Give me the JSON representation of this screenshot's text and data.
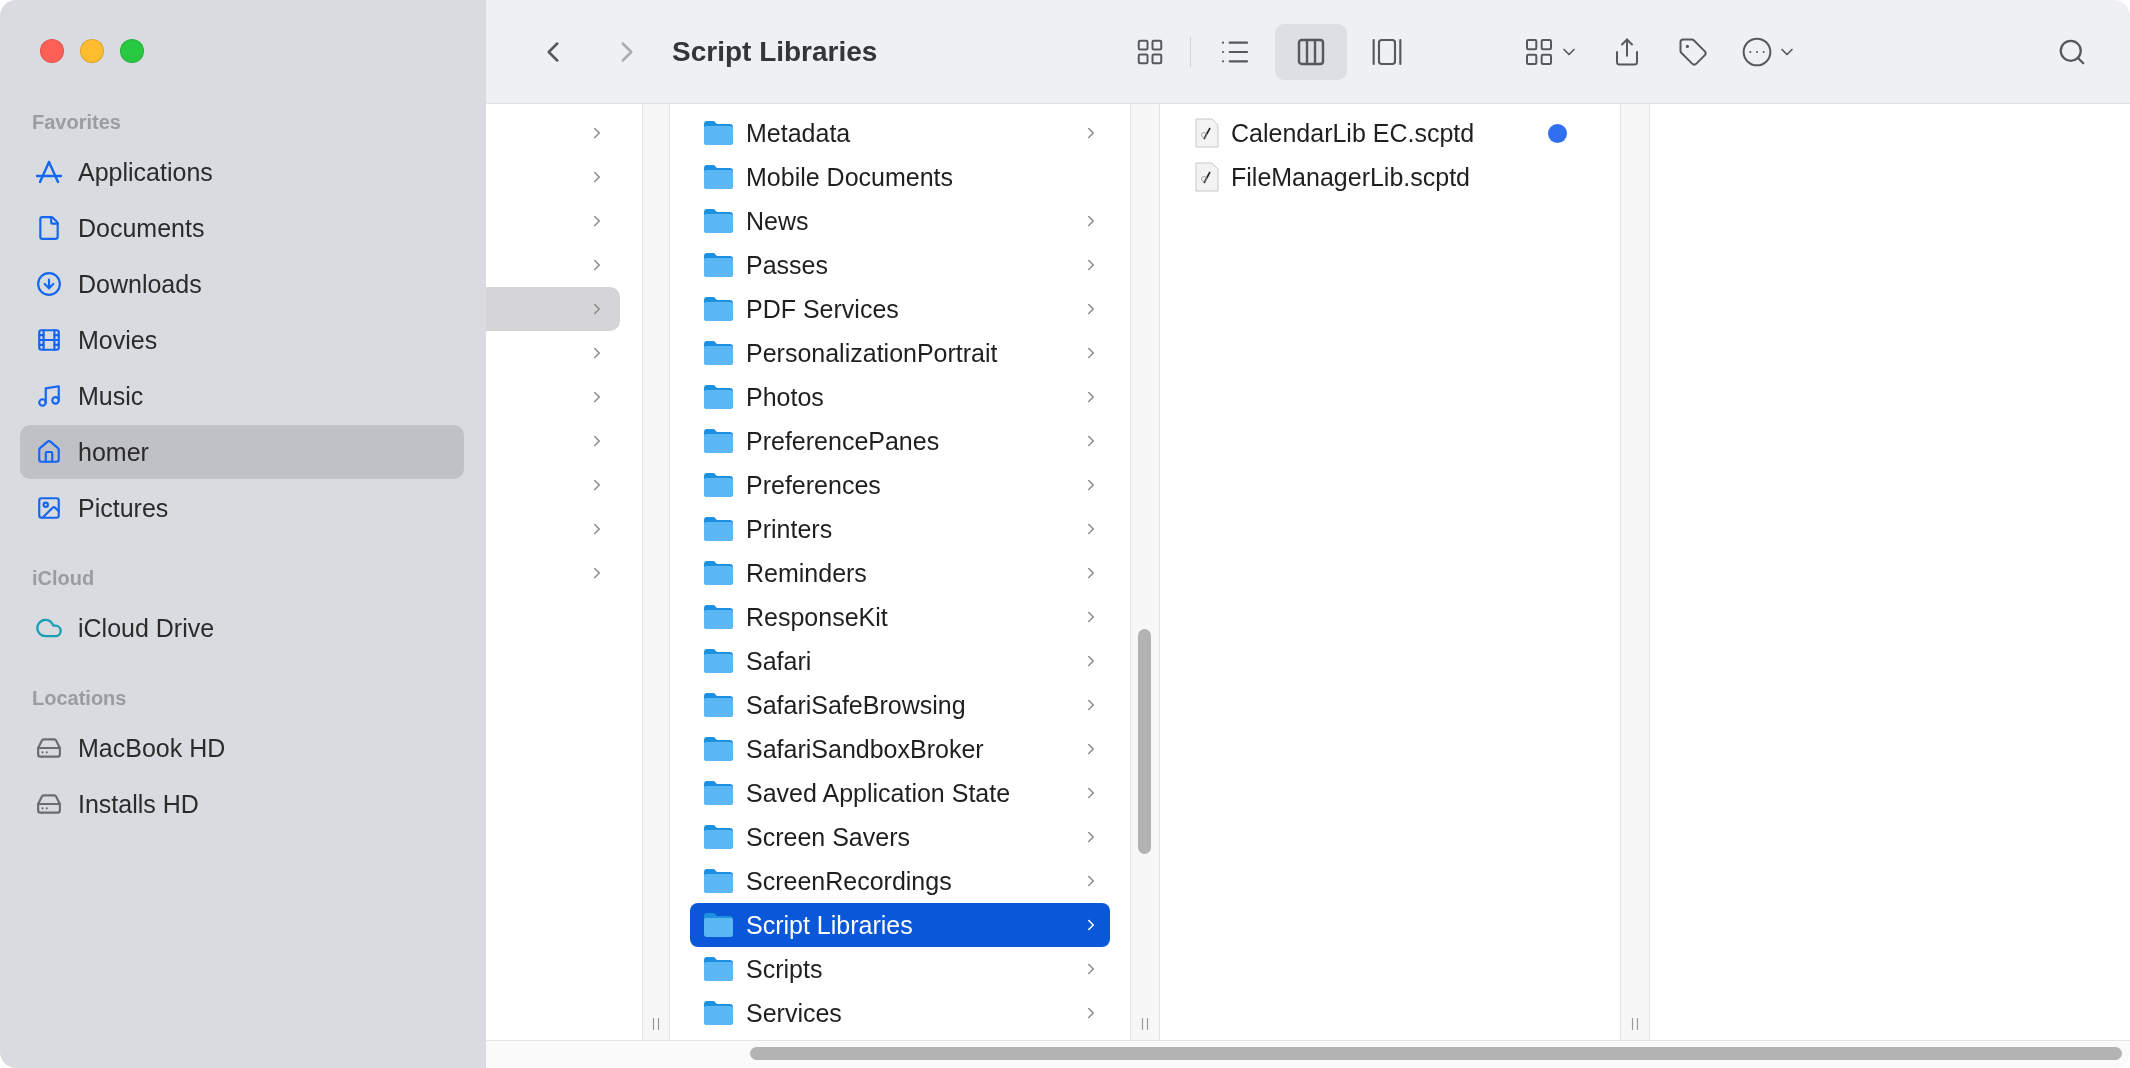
{
  "window": {
    "title": "Script Libraries"
  },
  "sidebar": {
    "sections": [
      {
        "header": "Favorites",
        "items": [
          {
            "label": "Applications",
            "kind": "applications",
            "selected": false
          },
          {
            "label": "Documents",
            "kind": "documents",
            "selected": false
          },
          {
            "label": "Downloads",
            "kind": "downloads",
            "selected": false
          },
          {
            "label": "Movies",
            "kind": "movies",
            "selected": false
          },
          {
            "label": "Music",
            "kind": "music",
            "selected": false
          },
          {
            "label": "homer",
            "kind": "home",
            "selected": true
          },
          {
            "label": "Pictures",
            "kind": "pictures",
            "selected": false
          }
        ]
      },
      {
        "header": "iCloud",
        "items": [
          {
            "label": "iCloud Drive",
            "kind": "cloud",
            "selected": false
          }
        ]
      },
      {
        "header": "Locations",
        "items": [
          {
            "label": "MacBook HD",
            "kind": "disk",
            "selected": false
          },
          {
            "label": "Installs HD",
            "kind": "disk",
            "selected": false
          }
        ]
      }
    ]
  },
  "toolbar": {
    "view_buttons": [
      {
        "kind": "icons",
        "selected": false
      },
      {
        "kind": "list",
        "selected": false
      },
      {
        "kind": "columns",
        "selected": true
      },
      {
        "kind": "gallery",
        "selected": false
      }
    ]
  },
  "column_1": {
    "rows": [
      {
        "selected": false
      },
      {
        "selected": false
      },
      {
        "selected": false
      },
      {
        "selected": false
      },
      {
        "selected": true
      },
      {
        "selected": false
      },
      {
        "selected": false
      },
      {
        "selected": false
      },
      {
        "selected": false
      },
      {
        "selected": false
      },
      {
        "selected": false
      }
    ]
  },
  "column_2": {
    "rows": [
      {
        "name": "Metadata",
        "has_children": true,
        "selected": false
      },
      {
        "name": "Mobile Documents",
        "has_children": false,
        "selected": false
      },
      {
        "name": "News",
        "has_children": true,
        "selected": false
      },
      {
        "name": "Passes",
        "has_children": true,
        "selected": false
      },
      {
        "name": "PDF Services",
        "has_children": true,
        "selected": false
      },
      {
        "name": "PersonalizationPortrait",
        "has_children": true,
        "selected": false
      },
      {
        "name": "Photos",
        "has_children": true,
        "selected": false
      },
      {
        "name": "PreferencePanes",
        "has_children": true,
        "selected": false
      },
      {
        "name": "Preferences",
        "has_children": true,
        "selected": false
      },
      {
        "name": "Printers",
        "has_children": true,
        "selected": false
      },
      {
        "name": "Reminders",
        "has_children": true,
        "selected": false
      },
      {
        "name": "ResponseKit",
        "has_children": true,
        "selected": false
      },
      {
        "name": "Safari",
        "has_children": true,
        "selected": false
      },
      {
        "name": "SafariSafeBrowsing",
        "has_children": true,
        "selected": false
      },
      {
        "name": "SafariSandboxBroker",
        "has_children": true,
        "selected": false
      },
      {
        "name": "Saved Application State",
        "has_children": true,
        "selected": false
      },
      {
        "name": "Screen Savers",
        "has_children": true,
        "selected": false
      },
      {
        "name": "ScreenRecordings",
        "has_children": true,
        "selected": false
      },
      {
        "name": "Script Libraries",
        "has_children": true,
        "selected": true
      },
      {
        "name": "Scripts",
        "has_children": true,
        "selected": false
      },
      {
        "name": "Services",
        "has_children": true,
        "selected": false
      }
    ]
  },
  "column_3": {
    "rows": [
      {
        "name": "CalendarLib EC.scptd",
        "color": "#2f6ff0"
      },
      {
        "name": "FileManagerLib.scptd"
      }
    ]
  }
}
